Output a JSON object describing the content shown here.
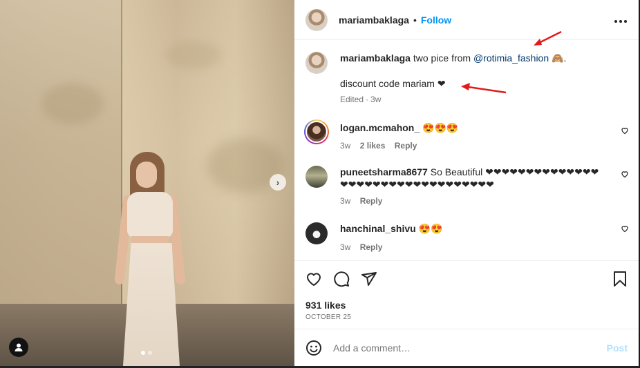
{
  "header": {
    "username": "mariambaklaga",
    "separator": "•",
    "follow_label": "Follow",
    "more_icon": "more-horizontal-icon"
  },
  "caption": {
    "username": "mariambaklaga",
    "text_before": "two pice from",
    "mention": "@rotimia_fashion",
    "text_after": "🙈.",
    "line2": "discount code mariam ❤",
    "edited": "Edited",
    "dot": "·",
    "time": "3w"
  },
  "comments": [
    {
      "username": "logan.mcmahon_",
      "text": "😍😍😍",
      "time": "3w",
      "likes": "2 likes",
      "reply": "Reply"
    },
    {
      "username": "puneetsharma8677",
      "text": "So Beautiful ❤❤❤❤❤❤❤❤❤❤❤❤❤❤❤❤❤❤❤❤❤❤❤❤❤❤❤❤❤❤❤❤❤",
      "time": "3w",
      "reply": "Reply"
    },
    {
      "username": "hanchinal_shivu",
      "text": "😍😍",
      "time": "3w",
      "reply": "Reply"
    }
  ],
  "actions": {
    "likes": "931 likes",
    "date": "OCTOBER 25"
  },
  "add_comment": {
    "placeholder": "Add a comment…",
    "post_label": "Post"
  },
  "photo": {
    "slide_index": 1,
    "slide_count": 2
  },
  "colors": {
    "accent": "#0095f6",
    "annotation_arrow": "#e01b1b"
  }
}
